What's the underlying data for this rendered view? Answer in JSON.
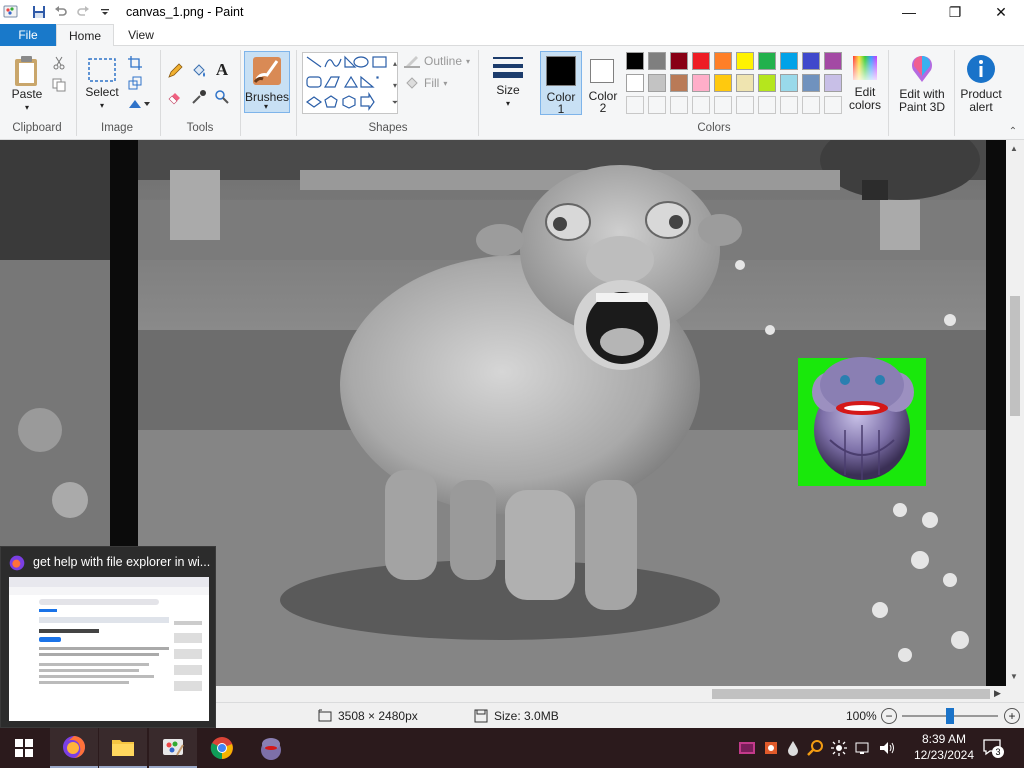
{
  "window": {
    "title": "canvas_1.png - Paint",
    "minimize": "—",
    "maximize": "❐",
    "close": "✕"
  },
  "tabs": {
    "file": "File",
    "home": "Home",
    "view": "View"
  },
  "ribbon": {
    "clipboard": {
      "paste": "Paste",
      "label": "Clipboard"
    },
    "image": {
      "select": "Select",
      "label": "Image"
    },
    "tools": {
      "label": "Tools"
    },
    "brushes": {
      "label": "Brushes"
    },
    "shapes": {
      "outline": "Outline",
      "fill": "Fill",
      "label": "Shapes"
    },
    "size": {
      "label": "Size"
    },
    "colors": {
      "color1": "Color",
      "color1_num": "1",
      "color2": "Color",
      "color2_num": "2",
      "label": "Colors",
      "edit_colors_1": "Edit",
      "edit_colors_2": "colors",
      "palette_row1": [
        "#000000",
        "#7f7f7f",
        "#880015",
        "#ed1c24",
        "#ff7f27",
        "#fff200",
        "#22b14c",
        "#00a2e8",
        "#3f48cc",
        "#a349a4"
      ],
      "palette_row2": [
        "#ffffff",
        "#c3c3c3",
        "#b97a57",
        "#ffaec9",
        "#ffc90e",
        "#efe4b0",
        "#b5e61d",
        "#99d9ea",
        "#7092be",
        "#c8bfe7"
      ]
    },
    "paint3d": {
      "line1": "Edit with",
      "line2": "Paint 3D"
    },
    "product_alert": {
      "line1": "Product",
      "line2": "alert"
    }
  },
  "status": {
    "dimensions": "3508 × 2480px",
    "size": "Size: 3.0MB",
    "zoom": "100%",
    "zoom_fraction": 0.5
  },
  "thumbnail": {
    "title": "get help with file explorer in wi..."
  },
  "taskbar": {
    "time": "8:39 AM",
    "date": "12/23/2024",
    "notification_count": "3"
  }
}
